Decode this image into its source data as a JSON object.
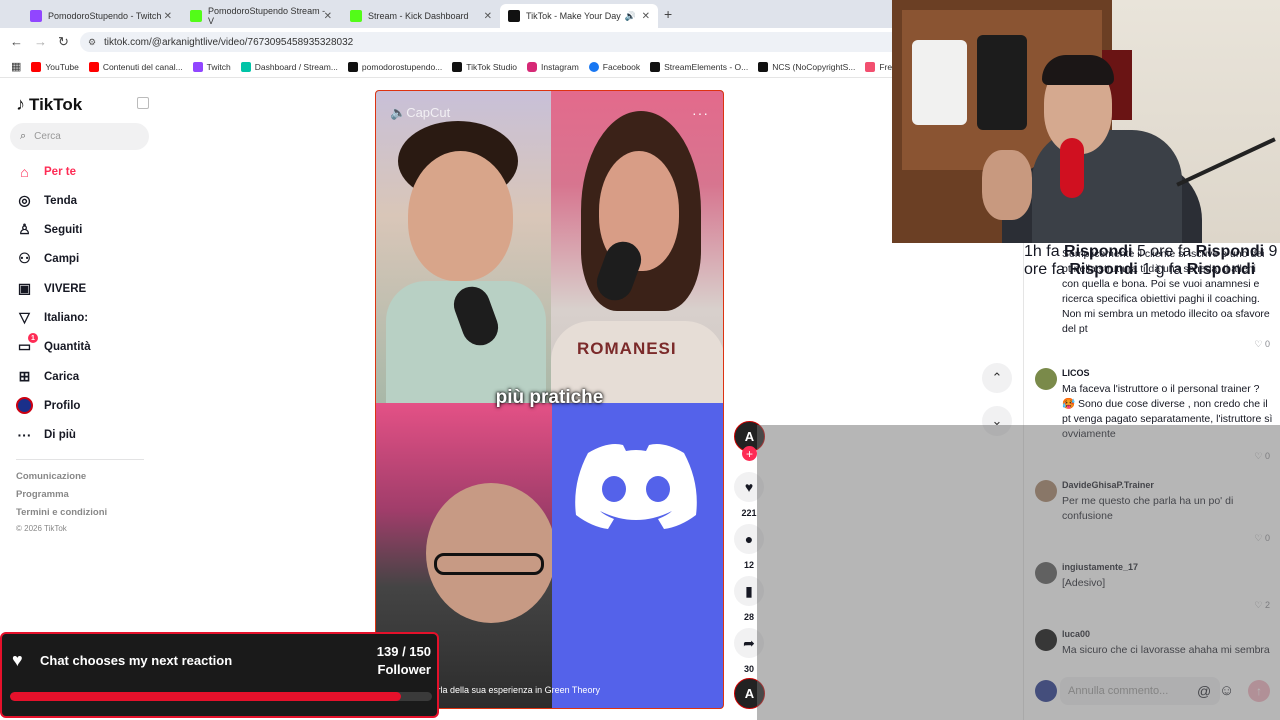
{
  "browser": {
    "tabs": [
      {
        "title": "PomodoroStupendo - Twitch",
        "icon": "twitch-icon",
        "color": "#9146ff"
      },
      {
        "title": "PomodoroStupendo Stream - V",
        "icon": "kick-icon",
        "color": "#53fc18"
      },
      {
        "title": "Stream - Kick Dashboard",
        "icon": "kick-icon",
        "color": "#53fc18"
      },
      {
        "title": "TikTok - Make Your Day",
        "icon": "tiktok-icon",
        "color": "#111111"
      }
    ],
    "url": "tiktok.com/@arkanightlive/video/7673095458935328032",
    "bookmarks": [
      {
        "label": "YouTube",
        "color": "#ff0000"
      },
      {
        "label": "Contenuti del canal...",
        "color": "#ff0000"
      },
      {
        "label": "Twitch",
        "color": "#9146ff"
      },
      {
        "label": "Dashboard / Stream...",
        "color": "#00c4a7"
      },
      {
        "label": "pomodorostupendo...",
        "color": "#111111"
      },
      {
        "label": "TikTok Studio",
        "color": "#111111"
      },
      {
        "label": "Instagram",
        "color": "#d62976"
      },
      {
        "label": "Facebook",
        "color": "#1877f2"
      },
      {
        "label": "StreamElements - O...",
        "color": "#111111"
      },
      {
        "label": "NCS (NoCopyrightS...",
        "color": "#111111"
      },
      {
        "label": "Freesou",
        "color": "#f24f6f"
      }
    ]
  },
  "sidebar": {
    "logo": "TikTok",
    "search_placeholder": "Cerca",
    "items": [
      {
        "label": "Per te",
        "icon": "home-icon"
      },
      {
        "label": "Tenda",
        "icon": "compass-icon"
      },
      {
        "label": "Seguiti",
        "icon": "following-icon"
      },
      {
        "label": "Campi",
        "icon": "friends-icon"
      },
      {
        "label": "VIVERE",
        "icon": "live-icon"
      },
      {
        "label": "Italiano:",
        "icon": "triangle-icon"
      },
      {
        "label": "Quantità",
        "icon": "inbox-icon",
        "badge": "1"
      },
      {
        "label": "Carica",
        "icon": "upload-icon"
      },
      {
        "label": "Profilo",
        "icon": "profile-icon"
      },
      {
        "label": "Di più",
        "icon": "more-icon"
      }
    ],
    "footer": [
      "Comunicazione",
      "Programma",
      "Termini e condizioni"
    ],
    "copyright": "© 2026 TikTok"
  },
  "video": {
    "watermark": "CapCut",
    "caption": "più pratiche",
    "description": "e parla della sua esperienza in Green Theory",
    "likes": "221",
    "comments": "12",
    "saves": "28",
    "shares": "30"
  },
  "comments": [
    {
      "user": "",
      "text": "Semplicemente il cliente si iscrive e uno dei pt nella struttura ti dà una scheda, ti alleni con quella e bona. Poi se vuoi anamnesi e ricerca specifica obiettivi paghi il coaching. Non mi sembra un metodo illecito oa sfavore del pt",
      "time": "1h fa",
      "reply": "Rispondi",
      "likes": "0"
    },
    {
      "user": "LICOS",
      "text": "Ma faceva l'istruttore o il personal trainer ? 🥵 Sono due cose diverse , non credo che il pt venga pagato separatamente, l'istruttore sì ovviamente",
      "time": "5 ore fa",
      "reply": "Rispondi",
      "likes": "0"
    },
    {
      "user": "DavideGhisaP.Trainer",
      "text": "Per me questo che parla ha un po' di confusione",
      "time": "9 ore fa",
      "reply": "Rispondi",
      "likes": "0"
    },
    {
      "user": "ingiustamente_17",
      "text": "[Adesivo]",
      "time": "1 g fa",
      "reply": "Rispondi",
      "likes": "2"
    },
    {
      "user": "luca00",
      "text": "Ma sicuro che ci lavorasse ahaha mi sembra",
      "time": "",
      "reply": "",
      "likes": ""
    }
  ],
  "comment_input_placeholder": "Annulla commento...",
  "widget": {
    "title": "Chat chooses my next reaction",
    "count": "139 / 150",
    "label": "Follower",
    "progress": 0.9267,
    "accent": "#e5112b"
  }
}
